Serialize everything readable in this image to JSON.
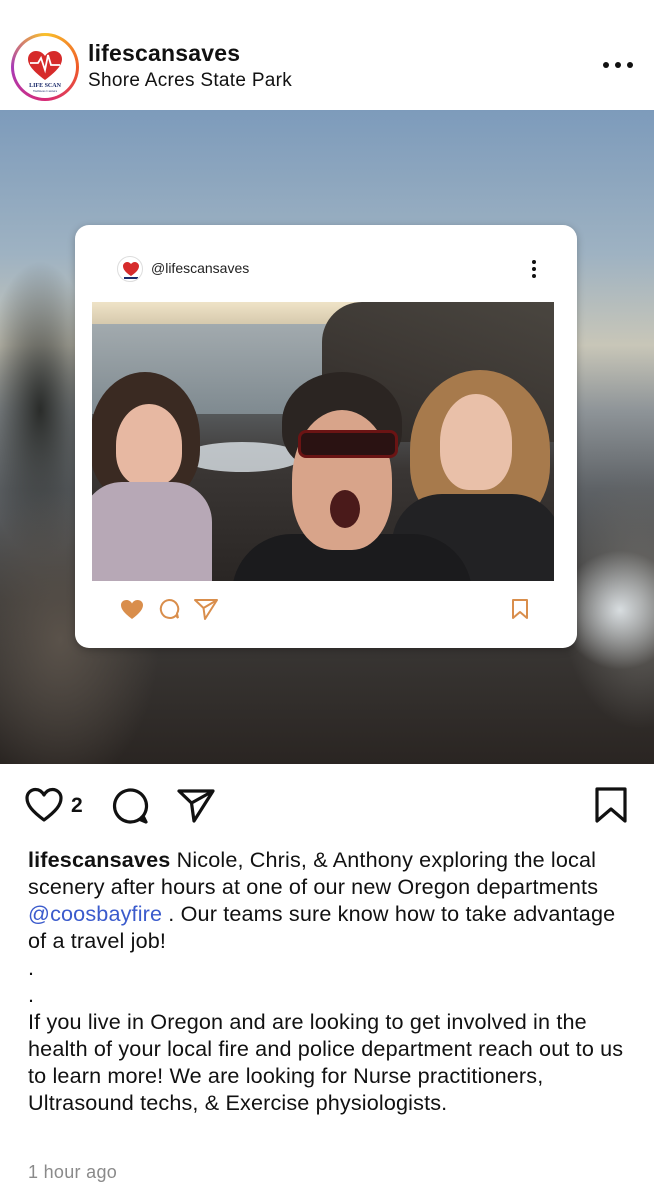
{
  "header": {
    "username": "lifescansaves",
    "location": "Shore Acres State Park",
    "avatar_text": "LIFE SCAN",
    "avatar_subtext": "Wellness Centers"
  },
  "post_image": {
    "card_username": "@lifescansaves",
    "accent_color": "#d98e4c"
  },
  "actions": {
    "like_count": "2"
  },
  "caption": {
    "username": "lifescansaves",
    "text_before_mention": " Nicole, Chris, & Anthony exploring the local scenery after hours at one of our new Oregon departments ",
    "mention": "@coosbayfire",
    "text_after_mention": " . Our teams sure know how to take advantage of a travel job!",
    "dot1": ".",
    "dot2": ".",
    "paragraph2": "If you live in Oregon and are looking to get involved in the health of your local fire and police department reach out to us to learn more! We are looking for Nurse practitioners, Ultrasound techs, & Exercise physiologists."
  },
  "timestamp": "1 hour ago",
  "colors": {
    "mention": "#3b5bcc",
    "brand_red": "#d62b2b",
    "timestamp": "#8a8a8a"
  }
}
